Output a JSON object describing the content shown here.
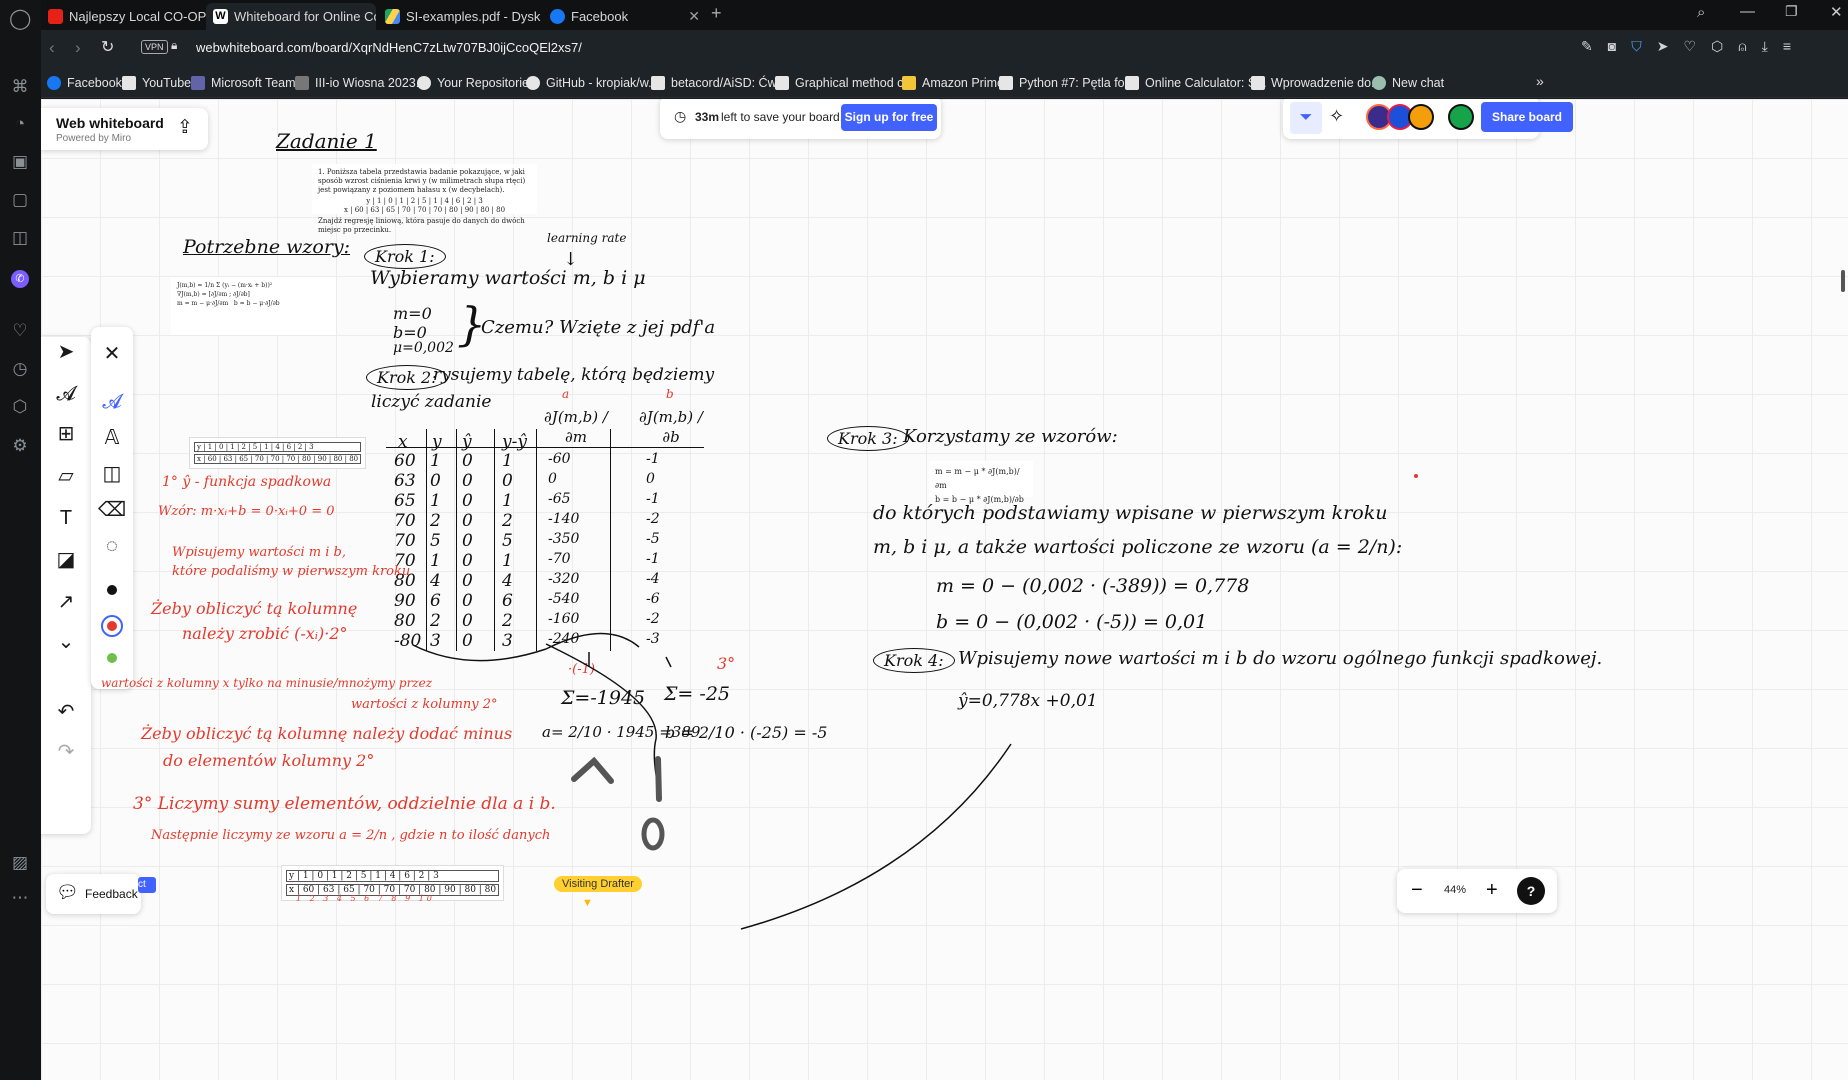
{
  "browser": {
    "tabs": [
      {
        "title": "Najlepszy Local CO-OP W I",
        "favicon_color": "#e62117"
      },
      {
        "title": "Whiteboard for Online Coll",
        "favicon_color": "#ffffff"
      },
      {
        "title": "SI-examples.pdf - Dysk Goo",
        "favicon_color": "#1fa463"
      },
      {
        "title": "Facebook",
        "favicon_color": "#1877f2"
      }
    ],
    "vpn_label": "VPN",
    "url": "webwhiteboard.com/board/XqrNdHenC7zLtw707BJ0ijCcoQEl2xs7/",
    "bookmarks": [
      "Facebook",
      "YouTube",
      "Microsoft Teams",
      "III-io Wiosna 2023....",
      "Your Repositories",
      "GitHub - kropiak/w...",
      "betacord/AiSD: Ćwi...",
      "Graphical method c...",
      "Amazon Prime",
      "Python #7: Pętla for...",
      "Online Calculator: S...",
      "Wprowadzenie do...",
      "New chat"
    ]
  },
  "app": {
    "brand_title": "Web whiteboard",
    "brand_sub": "Powered by Miro",
    "save_time": "33m",
    "save_text": "left to save your board.",
    "signup_label": "Sign up for free",
    "share_label": "Share board",
    "feedback_label": "Feedback",
    "zoom_level": "44%",
    "help_label": "?",
    "visiting_label": "Visiting Drafter",
    "partial_label": "ct"
  },
  "colors": {
    "accent": "#4262ff",
    "ink_red": "#e4392b",
    "ink_black": "#111111"
  },
  "board": {
    "title": "Zadanie 1",
    "printed_task": "1. Poniższa tabela przedstawia badanie pokazujące, w jaki sposób wzrost ciśnienia krwi y (w milimetrach słupa rtęci) jest powiązany z poziomem hałasu x (w decybelach).",
    "printed_task2": "Znajdź regresję liniową, która pasuje do danych do dwóch miejsc po przecinku.",
    "table_y": "y | 1 | 0 | 1 | 2 | 5 | 1 | 4 | 6 | 2 | 3",
    "table_x": "x | 60 | 63 | 65 | 70 | 70 | 70 | 80 | 90 | 80 | 80",
    "needed_formulas": "Potrzebne wzory:",
    "krok1": "Krok 1:",
    "learning_rate": "learning rate",
    "krok1_text": "Wybieramy wartości m, b i μ",
    "m0": "m=0",
    "b0": "b=0",
    "mu0": "μ=0,002",
    "why": "Czemu? Wzięte z jej pdf'a",
    "krok2": "Krok 2:",
    "krok2_text": "rysujemy tabelę, którą będziemy",
    "krok2_text2": "liczyć zadanie",
    "col_x": "x",
    "col_y": "y",
    "col_yhat": "ŷ",
    "col_diff": "y-ŷ",
    "col_dm": "∂J(m,b) / ∂m",
    "col_db": "∂J(m,b) / ∂b",
    "col_a": "a",
    "col_b": "b",
    "rows": [
      [
        "60",
        "1",
        "0",
        "1",
        "-60",
        "-1"
      ],
      [
        "63",
        "0",
        "0",
        "0",
        "0",
        "0"
      ],
      [
        "65",
        "1",
        "0",
        "1",
        "-65",
        "-1"
      ],
      [
        "70",
        "2",
        "0",
        "2",
        "-140",
        "-2"
      ],
      [
        "70",
        "5",
        "0",
        "5",
        "-350",
        "-5"
      ],
      [
        "70",
        "1",
        "0",
        "1",
        "-70",
        "-1"
      ],
      [
        "80",
        "4",
        "0",
        "4",
        "-320",
        "-4"
      ],
      [
        "90",
        "6",
        "0",
        "6",
        "-540",
        "-6"
      ],
      [
        "80",
        "2",
        "0",
        "2",
        "-160",
        "-2"
      ],
      [
        "-80",
        "3",
        "0",
        "3",
        "-240",
        "-3"
      ]
    ],
    "times_minus1": "·(-1)",
    "sum_a": "Σ=-1945",
    "sum_b": "Σ= -25",
    "a_calc": "a= 2/10 · 1945 =389",
    "b_calc": "b = 2/10 · (-25) = -5",
    "three_deg": "3°",
    "red_note1_title": "1° ŷ - funkcja spadkowa",
    "red_note1_formula": "Wzór: m·xᵢ+b = 0·xᵢ+0 = 0",
    "red_note1_text": "Wpisujemy wartości m i b,",
    "red_note1_text2": "które podaliśmy w pierwszym kroku",
    "red_note2": "Żeby obliczyć tą kolumnę",
    "red_note2b": "należy zrobić (-xᵢ)·2°",
    "red_note2c": "wartości z kolumny x tylko na minusie/mnożymy przez",
    "red_note2d": "wartości z kolumny 2°",
    "red_note3": "Żeby obliczyć tą kolumnę należy dodać minus",
    "red_note3b": "do elementów kolumny 2°",
    "red_note4": "3° Liczymy sumy elementów, oddzielnie dla a i b.",
    "red_note4b": "Następnie liczymy ze wzoru a = 2/n , gdzie n to ilość danych",
    "krok3": "Krok 3:",
    "krok3_text": "Korzystamy ze wzorów:",
    "formula_m": "m = m − μ * ∂J(m,b)/∂m",
    "formula_b": "b = b − μ * ∂J(m,b)/∂b",
    "krok3_l1": "do których podstawiamy wpisane w pierwszym kroku",
    "krok3_l2": "m, b i μ, a także wartości policzone ze wzoru (a = 2/n):",
    "m_result": "m = 0 − (0,002 · (-389)) = 0,778",
    "b_result": "b = 0 − (0,002 · (-5)) = 0,01",
    "krok4": "Krok 4:",
    "krok4_text": "Wpisujemy nowe wartości m i b do wzoru ogólnego funkcji spadkowej.",
    "final_eq": "ŷ=0,778x +0,01",
    "mini_index": "1 2 3 4 5 6 7 8 9 10"
  }
}
